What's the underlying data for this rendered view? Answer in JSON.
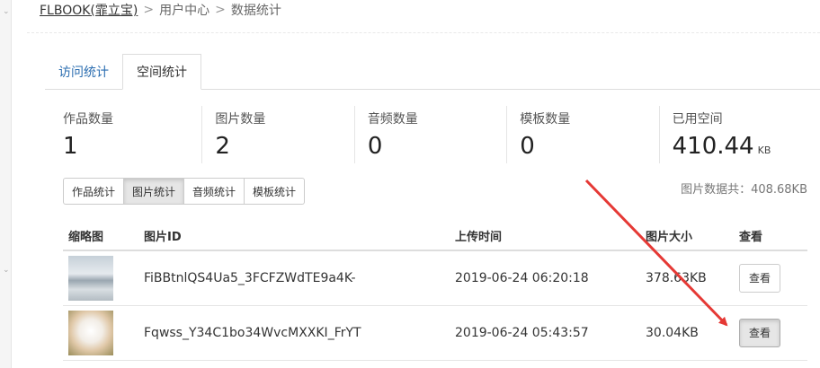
{
  "breadcrumb": {
    "home": "FLBOOK(霏立宝)",
    "sep": ">",
    "level1": "用户中心",
    "level2": "数据统计"
  },
  "tabs": [
    {
      "label": "访问统计",
      "active": false
    },
    {
      "label": "空间统计",
      "active": true
    }
  ],
  "stats": [
    {
      "label": "作品数量",
      "value": "1"
    },
    {
      "label": "图片数量",
      "value": "2"
    },
    {
      "label": "音频数量",
      "value": "0"
    },
    {
      "label": "模板数量",
      "value": "0"
    },
    {
      "label": "已用空间",
      "value": "410.44",
      "unit": "KB"
    }
  ],
  "filters": [
    {
      "label": "作品统计",
      "active": false
    },
    {
      "label": "图片统计",
      "active": true
    },
    {
      "label": "音频统计",
      "active": false
    },
    {
      "label": "模板统计",
      "active": false
    }
  ],
  "total_text": "图片数据共：408.68KB",
  "table": {
    "headers": [
      "缩略图",
      "图片ID",
      "上传时间",
      "图片大小",
      "查看"
    ],
    "rows": [
      {
        "thumb": "hall-photo-thumbnail",
        "id": "FiBBtnlQS4Ua5_3FCFZWdTE9a4K-",
        "time": "2019-06-24 06:20:18",
        "size": "378.63KB",
        "action": "查看"
      },
      {
        "thumb": "puppy-photo-thumbnail",
        "id": "Fqwss_Y34C1bo34WvcMXXKI_FrYT",
        "time": "2019-06-24 05:43:57",
        "size": "30.04KB",
        "action": "查看"
      }
    ]
  },
  "annotation": {
    "arrow_color": "#e53935"
  }
}
